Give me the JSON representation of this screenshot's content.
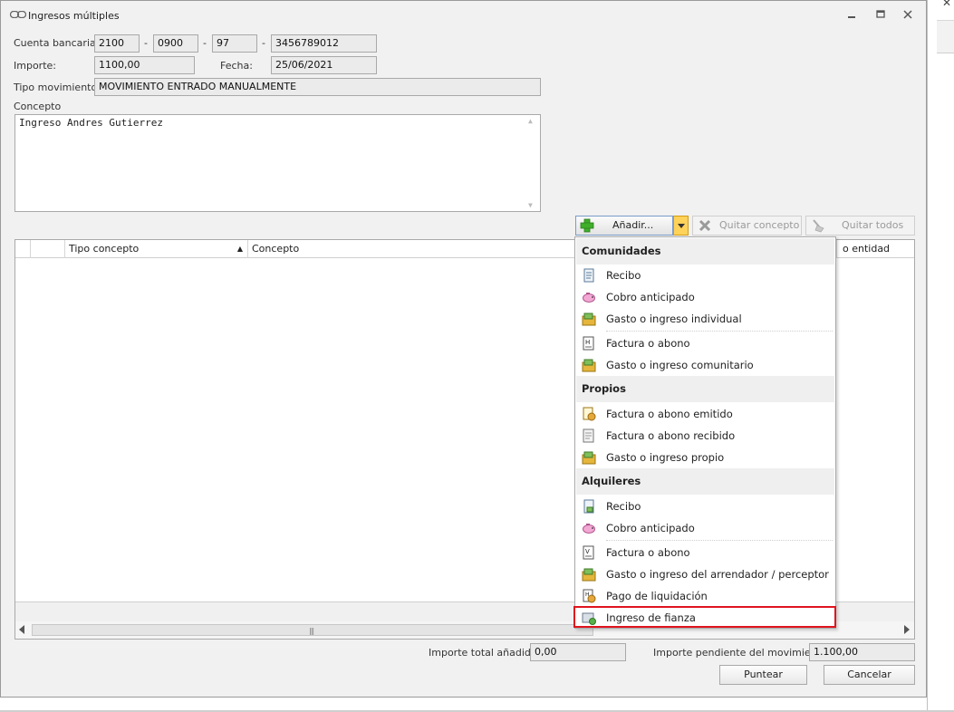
{
  "window": {
    "title": "Ingresos múltiples"
  },
  "form": {
    "cuenta_label": "Cuenta bancaria:",
    "cuenta": [
      "2100",
      "0900",
      "97",
      "3456789012"
    ],
    "importe_label": "Importe:",
    "importe": "1100,00",
    "fecha_label": "Fecha:",
    "fecha": "25/06/2021",
    "tipo_label": "Tipo movimiento:",
    "tipo": "MOVIMIENTO ENTRADO MANUALMENTE",
    "concepto_label": "Concepto",
    "concepto": "Ingreso Andres Gutierrez"
  },
  "toolbar": {
    "add": "Añadir...",
    "remove": "Quitar concepto",
    "remove_all": "Quitar todos"
  },
  "grid": {
    "columns": [
      "Tipo concepto",
      "Concepto",
      "o entidad"
    ]
  },
  "menu": {
    "sections": [
      {
        "title": "Comunidades",
        "items": [
          "Recibo",
          "Cobro anticipado",
          "Gasto o ingreso individual",
          "Factura o abono",
          "Gasto o ingreso comunitario"
        ]
      },
      {
        "title": "Propios",
        "items": [
          "Factura o abono emitido",
          "Factura o abono recibido",
          "Gasto o ingreso propio"
        ]
      },
      {
        "title": "Alquileres",
        "items": [
          "Recibo",
          "Cobro anticipado",
          "Factura o abono",
          "Gasto o ingreso del arrendador / perceptor",
          "Pago de liquidación",
          "Ingreso de fianza"
        ]
      }
    ]
  },
  "footer": {
    "total_label": "Importe total añadido:",
    "total": "0,00",
    "pendiente_label": "Importe pendiente del movimiento:",
    "pendiente": "1.100,00",
    "puntear": "Puntear",
    "cancelar": "Cancelar"
  }
}
